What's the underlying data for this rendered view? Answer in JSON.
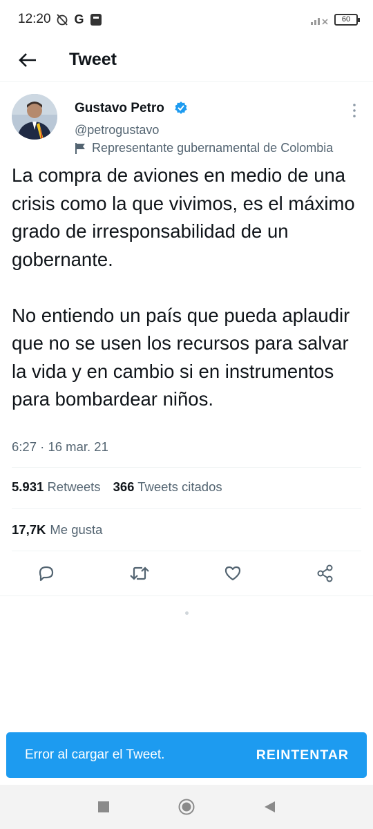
{
  "status_bar": {
    "time": "12:20",
    "g_label": "G",
    "battery": "60"
  },
  "header": {
    "title": "Tweet"
  },
  "tweet": {
    "author_name": "Gustavo Petro",
    "handle": "@petrogustavo",
    "label": "Representante gubernamental de Colombia",
    "text": "La compra de aviones en medio de una crisis como la que vivimos, es el máximo grado de irresponsabilidad de un gobernante.\n\nNo entiendo un país que pueda aplaudir que no se usen los recursos para salvar la vida y en cambio si en instrumentos para bombardear niños.",
    "timestamp": "6:27 · 16 mar. 21",
    "retweets_count": "5.931",
    "retweets_label": "Retweets",
    "quotes_count": "366",
    "quotes_label": "Tweets citados",
    "likes_count": "17,7K",
    "likes_label": "Me gusta"
  },
  "snackbar": {
    "message": "Error al cargar el Tweet.",
    "action": "REINTENTAR"
  },
  "colors": {
    "accent": "#1d9bf0",
    "text_primary": "#0f1419",
    "text_secondary": "#536471",
    "divider": "#eff3f4"
  },
  "icons": {
    "back": "arrow-left-icon",
    "verified": "verified-badge-icon",
    "more": "more-vertical-icon",
    "label": "flag-icon",
    "reply": "reply-icon",
    "retweet": "retweet-icon",
    "like": "heart-icon",
    "share": "share-icon"
  }
}
